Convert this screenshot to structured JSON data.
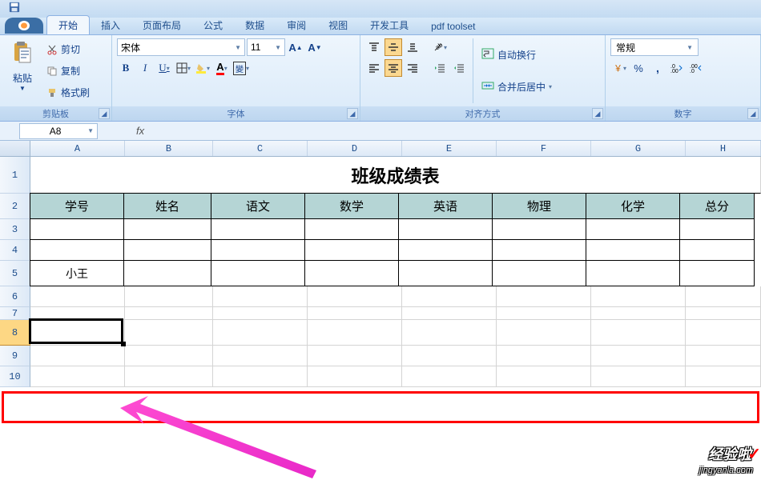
{
  "menu": {
    "tabs": [
      "开始",
      "插入",
      "页面布局",
      "公式",
      "数据",
      "审阅",
      "视图",
      "开发工具",
      "pdf toolset"
    ],
    "active_index": 0
  },
  "ribbon": {
    "clipboard": {
      "paste": "粘贴",
      "cut": "剪切",
      "copy": "复制",
      "format_painter": "格式刷",
      "group_label": "剪贴板"
    },
    "font": {
      "name": "宋体",
      "size": "11",
      "group_label": "字体"
    },
    "alignment": {
      "wrap": "自动换行",
      "merge": "合并后居中",
      "group_label": "对齐方式"
    },
    "number": {
      "format": "常规",
      "group_label": "数字"
    }
  },
  "formula_bar": {
    "cell_ref": "A8",
    "fx": "fx",
    "value": ""
  },
  "columns": [
    "A",
    "B",
    "C",
    "D",
    "E",
    "F",
    "G",
    "H"
  ],
  "rows": [
    "1",
    "2",
    "3",
    "4",
    "5",
    "6",
    "7",
    "8",
    "9",
    "10"
  ],
  "sheet": {
    "title": "班级成绩表",
    "headers": [
      "学号",
      "姓名",
      "语文",
      "数学",
      "英语",
      "物理",
      "化学",
      "总分"
    ],
    "data": {
      "A5": "小王"
    }
  },
  "watermark": {
    "cn": "经验啦",
    "check": "✓",
    "en": "jingyanla.com"
  }
}
